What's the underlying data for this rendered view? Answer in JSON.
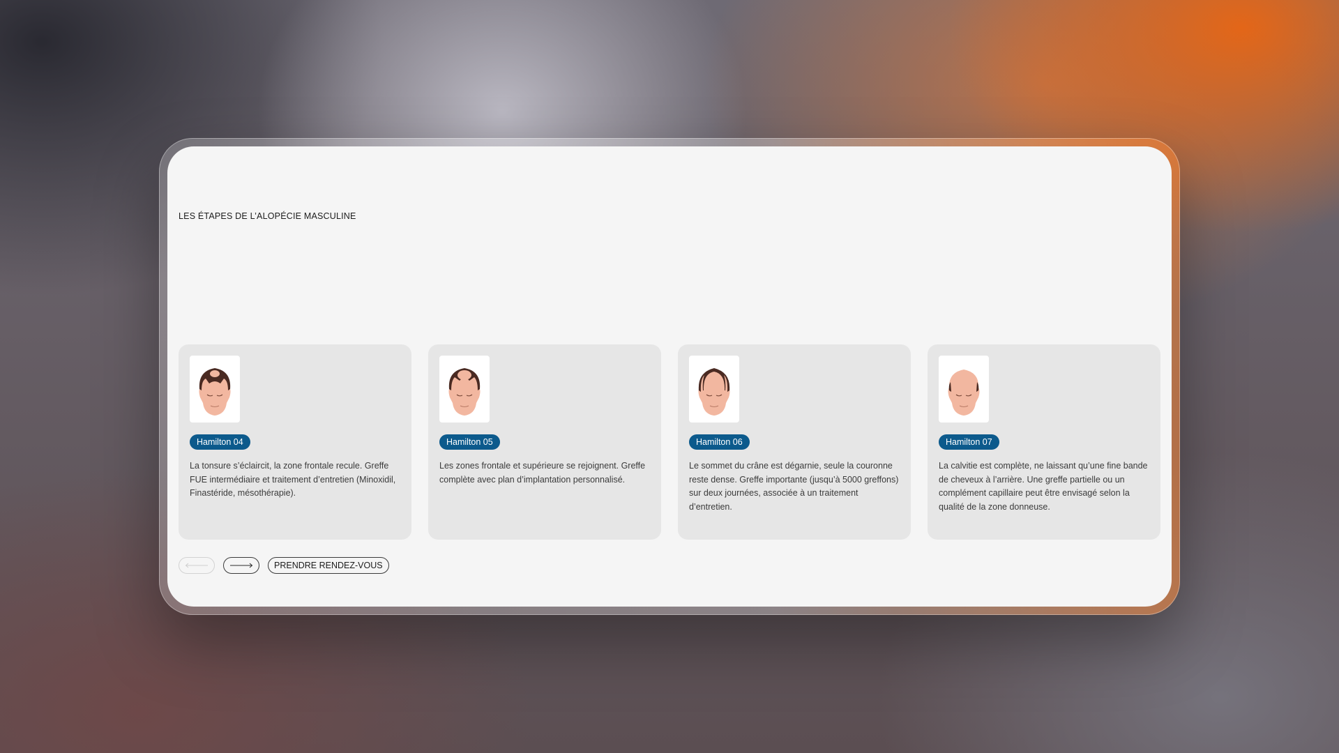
{
  "section": {
    "title": "LES ÉTAPES DE L’ALOPÉCIE MASCULINE"
  },
  "cards": [
    {
      "badge": "Hamilton 04",
      "description": "La tonsure s’éclaircit, la zone frontale recule. Greffe FUE intermédiaire et traitement d’entretien (Minoxidil, Finastéride, mésothérapie).",
      "icon": "head-hamilton-4-icon"
    },
    {
      "badge": "Hamilton 05",
      "description": "Les zones frontale et supérieure se rejoignent. Greffe complète avec plan d’implantation personnalisé.",
      "icon": "head-hamilton-5-icon"
    },
    {
      "badge": "Hamilton 06",
      "description": "Le sommet du crâne est dégarnie, seule la couronne reste dense. Greffe importante (jusqu’à 5000 greffons) sur deux journées, associée à un traitement d’entretien.",
      "icon": "head-hamilton-6-icon"
    },
    {
      "badge": "Hamilton 07",
      "description": "La calvitie est complète, ne laissant qu’une fine bande de cheveux à l’arrière. Une greffe partielle ou un complément capillaire peut être envisagé selon la qualité de la zone donneuse.",
      "icon": "head-hamilton-7-icon"
    }
  ],
  "controls": {
    "prev_icon": "arrow-left-icon",
    "next_icon": "arrow-right-icon",
    "cta_label": "PRENDRE RENDEZ-VOUS"
  },
  "colors": {
    "badge_bg": "#0c5a8c",
    "card_bg": "#e6e6e6",
    "panel_bg": "#f5f5f5",
    "accent_orange": "#e8661a"
  }
}
